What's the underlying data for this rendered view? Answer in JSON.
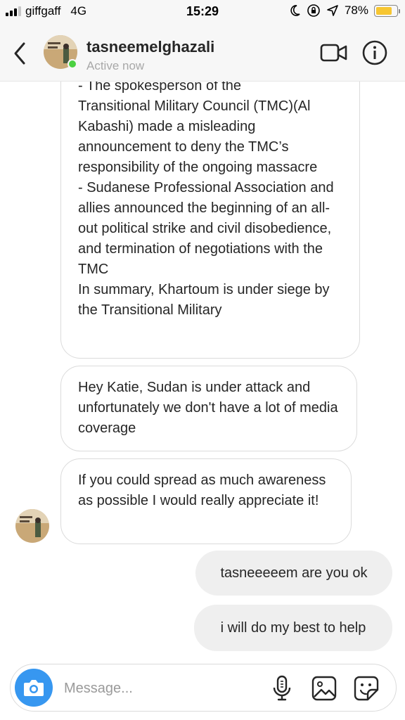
{
  "status_bar": {
    "carrier": "giffgaff",
    "network": "4G",
    "time": "15:29",
    "battery": "78%",
    "battery_level": 0.78
  },
  "header": {
    "username": "tasneemelghazali",
    "status": "Active now"
  },
  "messages": [
    {
      "direction": "incoming",
      "lines": [
        "- The spokesperson of the",
        "Transitional Military Council (TMC)(Al Kabashi) made a misleading announcement to deny the TMC’s responsibility of the ongoing massacre",
        "- Sudanese Professional Association and allies announced the beginning of an all-out political strike and civil disobedience, and termination of negotiations with the TMC",
        "In summary, Khartoum is under siege by the Transitional Military"
      ]
    },
    {
      "direction": "incoming",
      "text": "Hey Katie, Sudan is under attack and unfortunately we don't have a lot of media coverage"
    },
    {
      "direction": "incoming",
      "text": "If you could spread as much awareness as possible I would really appreciate it!"
    },
    {
      "direction": "outgoing",
      "text": "tasneeeeem are you ok"
    },
    {
      "direction": "outgoing",
      "text": "i will do my best to help"
    }
  ],
  "composer": {
    "placeholder": "Message..."
  },
  "icons": {
    "back": "chevron-left-icon",
    "video": "video-camera-icon",
    "info": "info-icon",
    "camera": "camera-icon",
    "mic": "microphone-icon",
    "gallery": "image-icon",
    "sticker": "sticker-icon"
  },
  "colors": {
    "accent": "#3797f0",
    "online": "#4bd141",
    "battery": "#f7c631",
    "outgoing_bubble": "#efefef"
  }
}
